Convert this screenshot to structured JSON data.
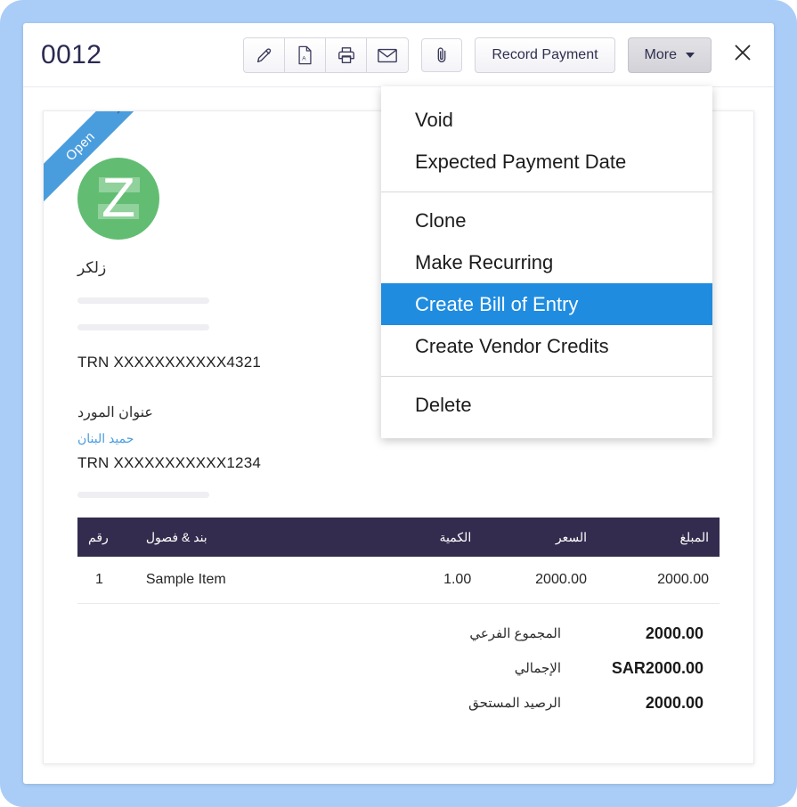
{
  "window": {
    "doc_number": "0012"
  },
  "toolbar": {
    "icons": [
      {
        "name": "edit-icon",
        "title": "Edit"
      },
      {
        "name": "pdf-icon",
        "title": "PDF"
      },
      {
        "name": "print-icon",
        "title": "Print"
      },
      {
        "name": "email-icon",
        "title": "Email"
      }
    ],
    "attachment_icon": "attachment-icon",
    "record_payment_label": "Record Payment",
    "more_label": "More",
    "close_icon": "close-icon"
  },
  "more_menu": {
    "groups": [
      {
        "items": [
          {
            "label": "Void",
            "selected": false
          },
          {
            "label": "Expected Payment Date",
            "selected": false
          }
        ]
      },
      {
        "items": [
          {
            "label": "Clone",
            "selected": false
          },
          {
            "label": "Make Recurring",
            "selected": false
          },
          {
            "label": "Create Bill of Entry",
            "selected": true
          },
          {
            "label": "Create Vendor Credits",
            "selected": false
          }
        ]
      },
      {
        "items": [
          {
            "label": "Delete",
            "selected": false
          }
        ]
      }
    ]
  },
  "invoice": {
    "status_ribbon": "Open",
    "logo_letter": "Z",
    "vendor_name": "زلكر",
    "vendor_trn": "TRN XXXXXXXXXXX4321",
    "billing_address_label": "عنوان المورد",
    "billing_link": "حميد البنان",
    "billing_trn": "TRN XXXXXXXXXXX1234",
    "table": {
      "headers": {
        "no": "رقم",
        "item": "بند & فصول",
        "qty": "الكمية",
        "rate": "السعر",
        "amount": "المبلغ"
      },
      "rows": [
        {
          "no": "1",
          "item": "Sample Item",
          "qty": "1.00",
          "rate": "2000.00",
          "amount": "2000.00"
        }
      ]
    },
    "totals": [
      {
        "label": "المجموع الفرعي",
        "value": "2000.00"
      },
      {
        "label": "الإجمالي",
        "value": "SAR2000.00"
      },
      {
        "label": "الرصيد المستحق",
        "value": "2000.00"
      }
    ]
  },
  "colors": {
    "frame_blue": "#a9cdf7",
    "ribbon_blue": "#4a9ddd",
    "logo_green": "#62bd72",
    "table_header": "#342c4e",
    "menu_highlight": "#1f8ce0",
    "link_blue": "#4a9ddd"
  }
}
